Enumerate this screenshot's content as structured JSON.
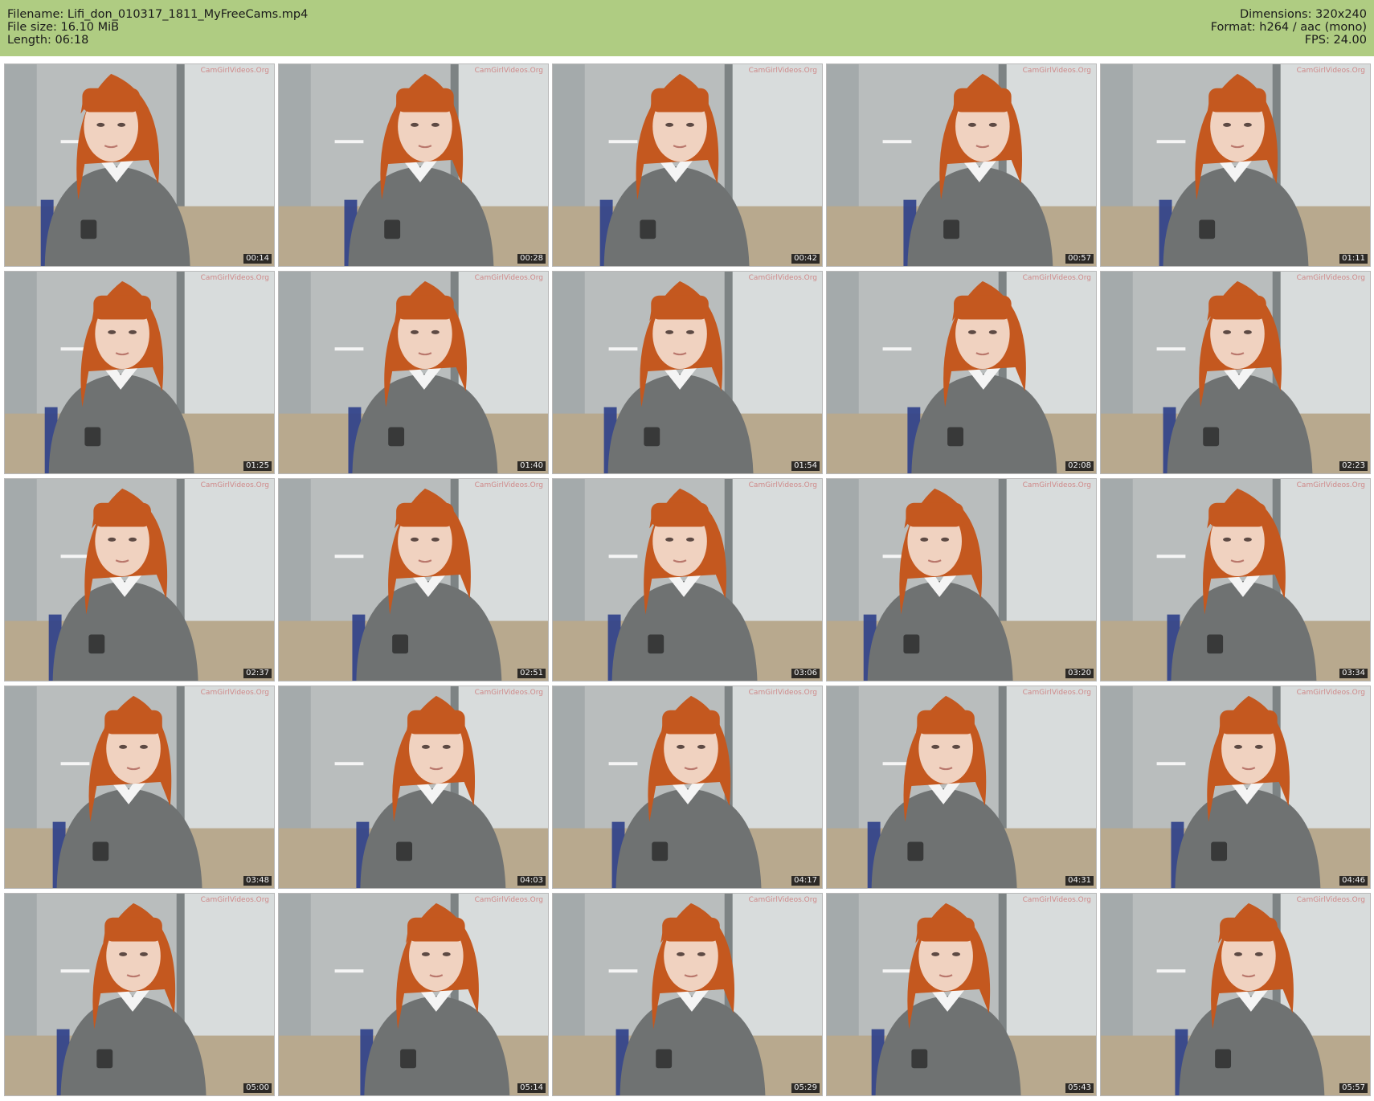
{
  "header": {
    "filename_line": "Filename: Lifi_don_010317_1811_MyFreeCams.mp4",
    "filesize_line": "File size: 16.10 MiB",
    "length_line": "Length: 06:18",
    "dimensions_line": "Dimensions: 320x240",
    "format_line": "Format: h264 / aac (mono)",
    "fps_line": "FPS: 24.00"
  },
  "watermark": "CamGirlVideos.Org",
  "colors": {
    "header_bg": "#afcc82",
    "hair": "#c4581f",
    "sweater": "#6f7272",
    "collar": "#f4f4f4",
    "wall": "#c2c5c5",
    "desk": "#b8a98e"
  },
  "thumbnails": [
    {
      "time": "00:14"
    },
    {
      "time": "00:28"
    },
    {
      "time": "00:42"
    },
    {
      "time": "00:57"
    },
    {
      "time": "01:11"
    },
    {
      "time": "01:25"
    },
    {
      "time": "01:40"
    },
    {
      "time": "01:54"
    },
    {
      "time": "02:08"
    },
    {
      "time": "02:23"
    },
    {
      "time": "02:37"
    },
    {
      "time": "02:51"
    },
    {
      "time": "03:06"
    },
    {
      "time": "03:20"
    },
    {
      "time": "03:34"
    },
    {
      "time": "03:48"
    },
    {
      "time": "04:03"
    },
    {
      "time": "04:17"
    },
    {
      "time": "04:31"
    },
    {
      "time": "04:46"
    },
    {
      "time": "05:00"
    },
    {
      "time": "05:14"
    },
    {
      "time": "05:29"
    },
    {
      "time": "05:43"
    },
    {
      "time": "05:57"
    }
  ]
}
